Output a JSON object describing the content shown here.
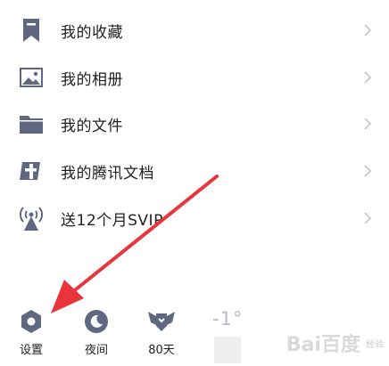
{
  "menu": {
    "items": [
      {
        "label": "我的收藏",
        "icon": "bookmark-icon"
      },
      {
        "label": "我的相册",
        "icon": "image-icon"
      },
      {
        "label": "我的文件",
        "icon": "folder-icon"
      },
      {
        "label": "我的腾讯文档",
        "icon": "tencent-docs-icon"
      },
      {
        "label": "送12个月SVIP",
        "icon": "signal-tower-icon"
      }
    ]
  },
  "bottom_bar": {
    "settings_label": "设置",
    "night_label": "夜间",
    "days_label": "80天",
    "weather_temp": "-1°"
  },
  "watermark": {
    "text": "Bai百度",
    "sub": "经验"
  },
  "colors": {
    "icon": "#5f6781",
    "arrow": "#e8343a",
    "chevron": "#c4c4c4"
  }
}
